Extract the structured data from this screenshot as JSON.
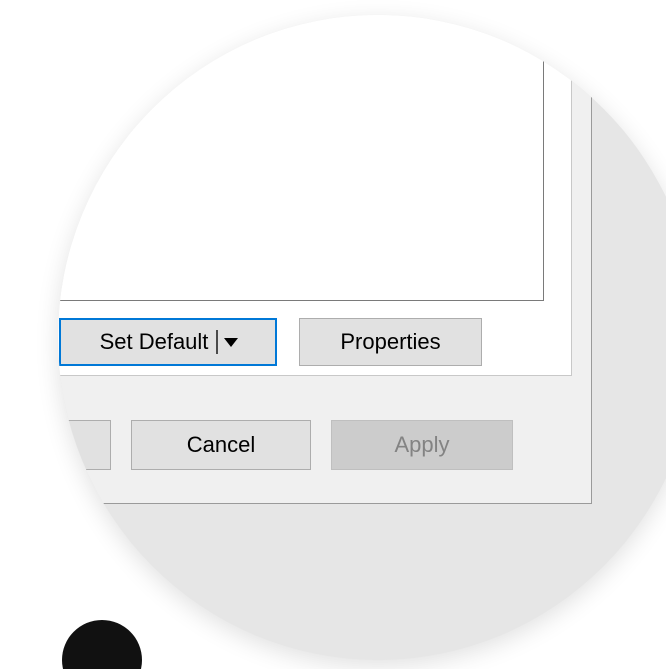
{
  "dialog": {
    "buttons": {
      "set_default": "Set Default",
      "properties": "Properties",
      "cancel": "Cancel",
      "apply": "Apply"
    }
  },
  "colors": {
    "focus_accent": "#0078d7",
    "button_face": "#e1e1e1",
    "disabled_face": "#cccccc",
    "magnifier_bg": "#e6e6e6"
  },
  "icons": {
    "split_dropdown": "chevron-down-icon"
  }
}
